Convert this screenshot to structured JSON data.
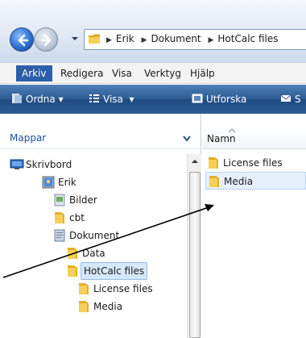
{
  "address": {
    "crumbs": [
      "Erik",
      "Dokument",
      "HotCalc files"
    ]
  },
  "menu": {
    "items": [
      "Arkiv",
      "Redigera",
      "Visa",
      "Verktyg",
      "Hjälp"
    ]
  },
  "toolbar": {
    "ordna": "Ordna",
    "visa": "Visa",
    "utforska": "Utforska",
    "partial": "S"
  },
  "folders": {
    "title": "Mappar",
    "tree": [
      {
        "label": "Skrivbord",
        "icon": "desktop-icon"
      },
      {
        "label": "Erik",
        "icon": "user-folder-icon"
      },
      {
        "label": "Bilder",
        "icon": "pictures-folder-icon"
      },
      {
        "label": "cbt",
        "icon": "folder-icon"
      },
      {
        "label": "Dokument",
        "icon": "documents-folder-icon"
      },
      {
        "label": "Data",
        "icon": "folder-icon"
      },
      {
        "label": "HotCalc files",
        "icon": "folder-icon"
      },
      {
        "label": "License files",
        "icon": "folder-icon"
      },
      {
        "label": "Media",
        "icon": "folder-icon"
      }
    ]
  },
  "content": {
    "column_name": "Namn",
    "files": [
      "License files",
      "Media"
    ]
  },
  "colors": {
    "accent": "#2d5ea8",
    "folder": "#f2c14e",
    "toolbar": "#2c5a92"
  }
}
